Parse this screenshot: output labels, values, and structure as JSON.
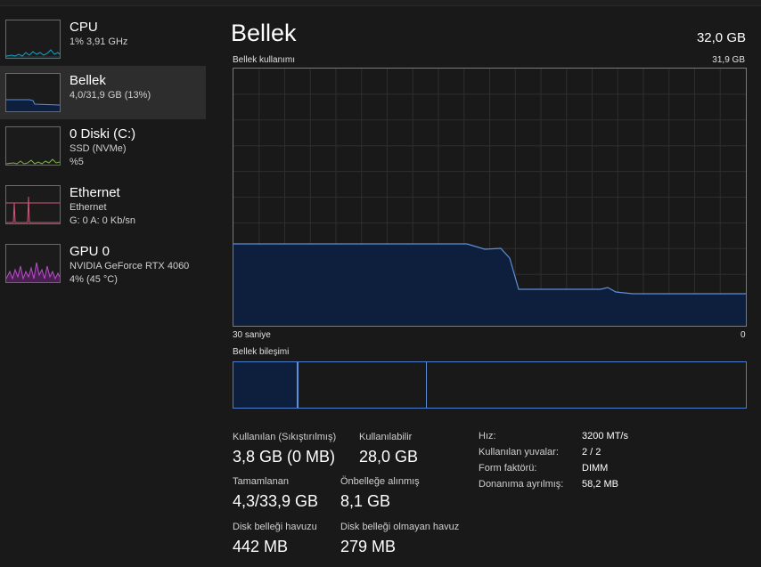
{
  "sidebar": {
    "items": [
      {
        "title": "CPU",
        "lines": [
          "1% 3,91 GHz"
        ]
      },
      {
        "title": "Bellek",
        "lines": [
          "4,0/31,9 GB (13%)"
        ]
      },
      {
        "title": "0 Diski (C:)",
        "lines": [
          "SSD (NVMe)",
          "%5"
        ]
      },
      {
        "title": "Ethernet",
        "lines": [
          "Ethernet",
          "G: 0 A: 0 Kb/sn"
        ]
      },
      {
        "title": "GPU 0",
        "lines": [
          "NVIDIA GeForce RTX 4060",
          "4% (45 °C)"
        ]
      }
    ]
  },
  "main": {
    "title": "Bellek",
    "total": "32,0 GB",
    "usage_label": "Bellek kullanımı",
    "usage_max": "31,9 GB",
    "time_left": "30 saniye",
    "time_right": "0",
    "composition_label": "Bellek bileşimi"
  },
  "stats": {
    "in_use_label": "Kullanılan (Sıkıştırılmış)",
    "in_use_value": "3,8 GB (0 MB)",
    "available_label": "Kullanılabilir",
    "available_value": "28,0 GB",
    "committed_label": "Tamamlanan",
    "committed_value": "4,3/33,9 GB",
    "cached_label": "Önbelleğe alınmış",
    "cached_value": "8,1 GB",
    "paged_label": "Disk belleği havuzu",
    "paged_value": "442 MB",
    "nonpaged_label": "Disk belleği olmayan havuz",
    "nonpaged_value": "279 MB"
  },
  "details": [
    {
      "label": "Hız:",
      "value": "3200 MT/s"
    },
    {
      "label": "Kullanılan yuvalar:",
      "value": "2 / 2"
    },
    {
      "label": "Form faktörü:",
      "value": "DIMM"
    },
    {
      "label": "Donanıma ayrılmış:",
      "value": "58,2 MB"
    }
  ],
  "colors": {
    "memory": "#5e8fd8",
    "memory_fill": "#0e1f3d",
    "cpu": "#17a2c8",
    "disk": "#7db83a",
    "ethernet": "#d4557a",
    "gpu": "#b84fc8"
  }
}
